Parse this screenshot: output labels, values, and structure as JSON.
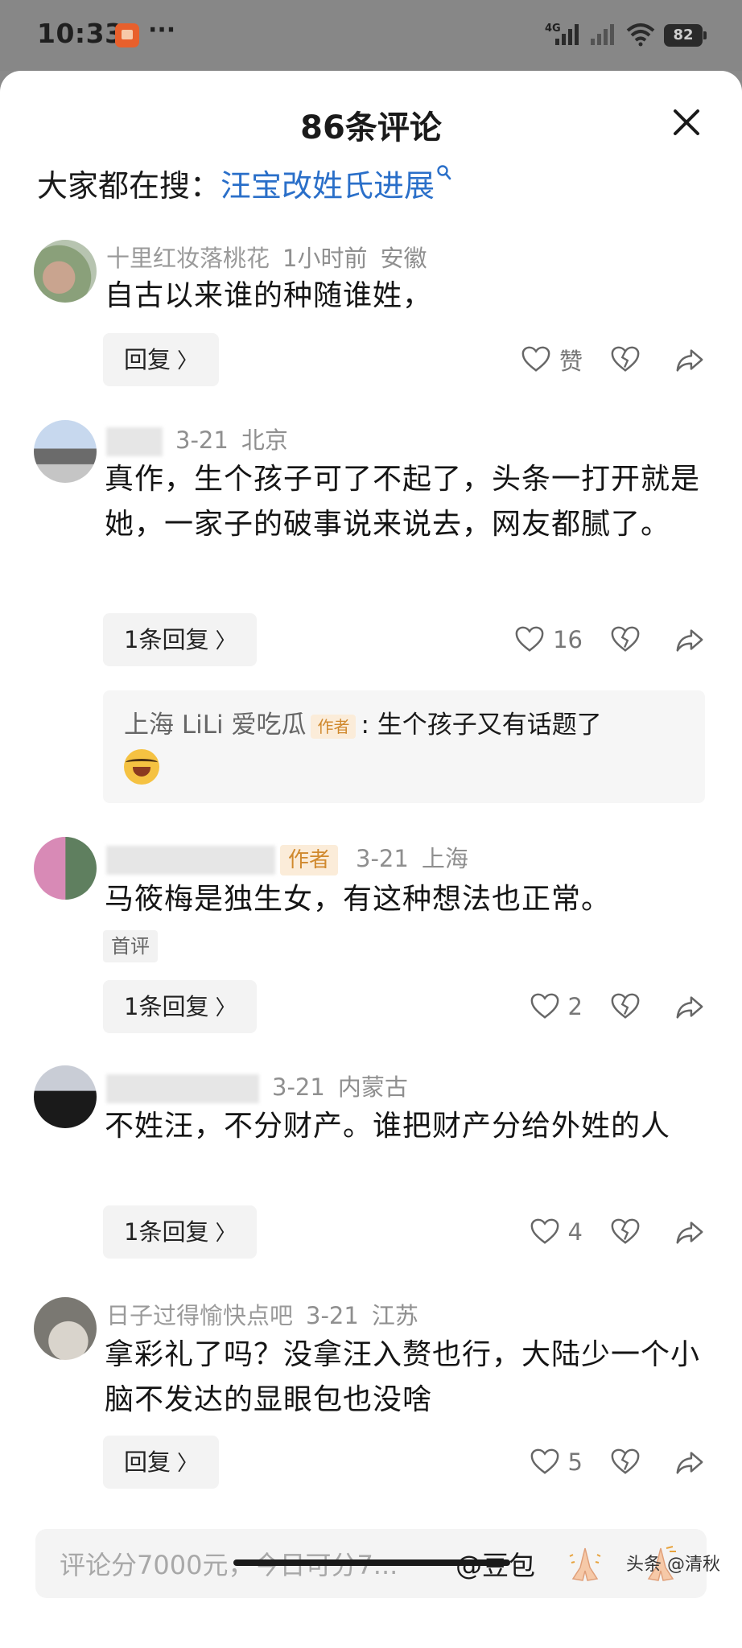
{
  "status_bar": {
    "time": "10:33",
    "dots": "···",
    "network": "4G",
    "battery": "82"
  },
  "sheet": {
    "title": "86条评论",
    "close_icon": "close-icon"
  },
  "search": {
    "prefix": "大家都在搜：",
    "term": "汪宝改姓氏进展"
  },
  "comments": [
    {
      "name": "十里红妆落桃花",
      "time": "1小时前",
      "location": "安徽",
      "text": "自古以来谁的种随谁姓，",
      "reply_label": "回复",
      "like_label": "赞"
    },
    {
      "name": "",
      "time": "3-21",
      "location": "北京",
      "text": "真作，生个孩子可了不起了，头条一打开就是她，一家子的破事说来说去，网友都腻了。",
      "reply_label": "1条回复",
      "like_count": "16",
      "sub_reply": {
        "name": "上海 LiLi 爱吃瓜",
        "tag": "作者",
        "text": "生个孩子又有话题了"
      }
    },
    {
      "name": "",
      "tag": "作者",
      "time": "3-21",
      "location": "上海",
      "text": "马筱梅是独生女，有这种想法也正常。",
      "badge": "首评",
      "reply_label": "1条回复",
      "like_count": "2"
    },
    {
      "name": "",
      "time": "3-21",
      "location": "内蒙古",
      "text": "不姓汪，不分财产。谁把财产分给外姓的人",
      "reply_label": "1条回复",
      "like_count": "4"
    },
    {
      "name": "日子过得愉快点吧",
      "time": "3-21",
      "location": "江苏",
      "text": "拿彩礼了吗？没拿汪入赘也行，大陆少一个小脑不发达的显眼包也没啥",
      "reply_label": "回复",
      "like_count": "5"
    }
  ],
  "input": {
    "placeholder": "评论分7000元，今日可分7...",
    "mention": "@豆包"
  },
  "watermark": "头条 @清秋",
  "colors": {
    "link": "#2a6fc9",
    "author_tag_bg": "#fbecd9",
    "author_tag_text": "#d0892e",
    "muted": "#8f8f8f"
  }
}
